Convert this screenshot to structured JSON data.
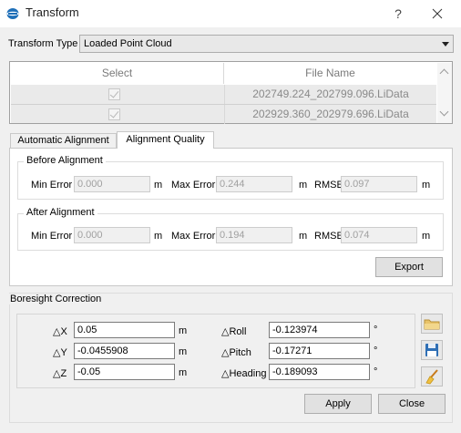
{
  "window": {
    "title": "Transform",
    "help_label": "?"
  },
  "colors": {
    "accent": "#1e6fb8",
    "folder": "#e8c36a",
    "save": "#2f6fb5"
  },
  "transform_type": {
    "label": "Transform Type",
    "selected": "Loaded Point Cloud"
  },
  "table": {
    "headers": [
      "Select",
      "File Name"
    ],
    "rows": [
      {
        "checked": true,
        "file": "202749.224_202799.096.LiData"
      },
      {
        "checked": true,
        "file": "202929.360_202979.696.LiData"
      }
    ]
  },
  "tabs": [
    "Automatic Alignment",
    "Alignment Quality"
  ],
  "active_tab": 1,
  "alignment_quality": {
    "before": {
      "title": "Before Alignment",
      "min_error_label": "Min Error",
      "min_error": "0.000",
      "max_error_label": "Max Error",
      "max_error": "0.244",
      "rmse_label": "RMSE",
      "rmse": "0.097",
      "unit": "m"
    },
    "after": {
      "title": "After Alignment",
      "min_error_label": "Min Error",
      "min_error": "0.000",
      "max_error_label": "Max Error",
      "max_error": "0.194",
      "rmse_label": "RMSE",
      "rmse": "0.074",
      "unit": "m"
    },
    "export_label": "Export"
  },
  "boresight": {
    "title": "Boresight Correction",
    "dx_label": "△X",
    "dx": "0.05",
    "dy_label": "△Y",
    "dy": "-0.0455908",
    "dz_label": "△Z",
    "dz": "-0.05",
    "roll_label": "△Roll",
    "roll": "-0.123974",
    "pitch_label": "△Pitch",
    "pitch": "-0.17271",
    "heading_label": "△Heading",
    "heading": "-0.189093",
    "len_unit": "m",
    "angle_unit": "°"
  },
  "buttons": {
    "apply": "Apply",
    "close": "Close"
  },
  "icons": {
    "app": "app-logo-icon",
    "open": "folder-icon",
    "save": "save-icon",
    "clear": "broom-icon"
  }
}
